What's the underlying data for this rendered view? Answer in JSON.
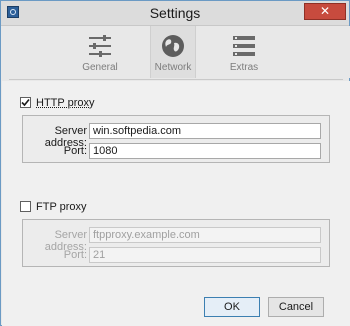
{
  "window": {
    "title": "Settings",
    "close_glyph": "✕"
  },
  "toolbar": {
    "tabs": [
      {
        "label": "General",
        "icon": "sliders-icon"
      },
      {
        "label": "Network",
        "icon": "globe-icon",
        "active": true
      },
      {
        "label": "Extras",
        "icon": "list-icon"
      }
    ]
  },
  "http_proxy": {
    "label": "HTTP proxy",
    "checked": true,
    "server_label": "Server address:",
    "server_value": "win.softpedia.com",
    "port_label": "Port:",
    "port_value": "1080"
  },
  "ftp_proxy": {
    "label": "FTP proxy",
    "checked": false,
    "server_label": "Server address:",
    "server_placeholder": "ftpproxy.example.com",
    "port_label": "Port:",
    "port_placeholder": "21"
  },
  "buttons": {
    "ok": "OK",
    "cancel": "Cancel"
  },
  "colors": {
    "accent": "#3c7fb1",
    "close": "#c74b3e",
    "titlebar": "#dcdcdc"
  }
}
